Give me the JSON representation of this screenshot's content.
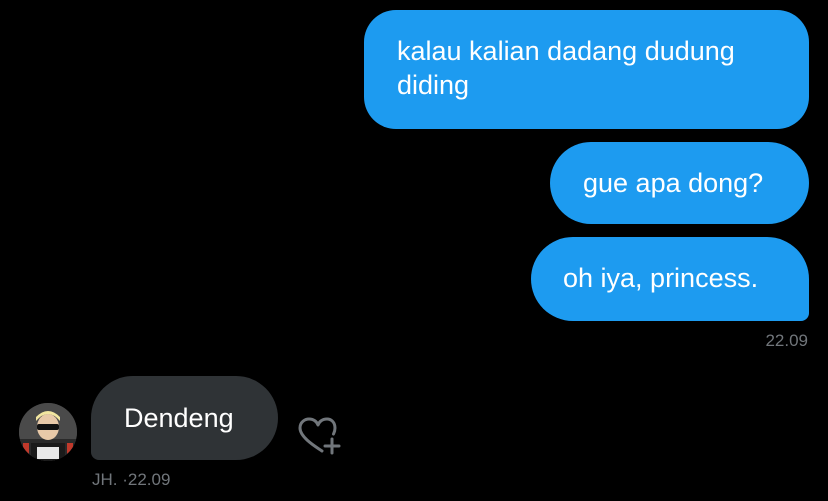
{
  "messages": {
    "outgoing": [
      {
        "text": "kalau kalian dadang dudung diding"
      },
      {
        "text": "gue apa dong?"
      },
      {
        "text": "oh iya, princess."
      }
    ],
    "outgoing_time": "22.09",
    "incoming": {
      "text": "Dendeng",
      "meta": "JH. ·22.09"
    }
  },
  "icons": {
    "reaction": "heart-plus-icon",
    "avatar": "user-avatar"
  },
  "colors": {
    "background": "#000000",
    "outgoing_bubble": "#1d9bf0",
    "incoming_bubble": "#2f3336",
    "timestamp": "#71767b"
  }
}
